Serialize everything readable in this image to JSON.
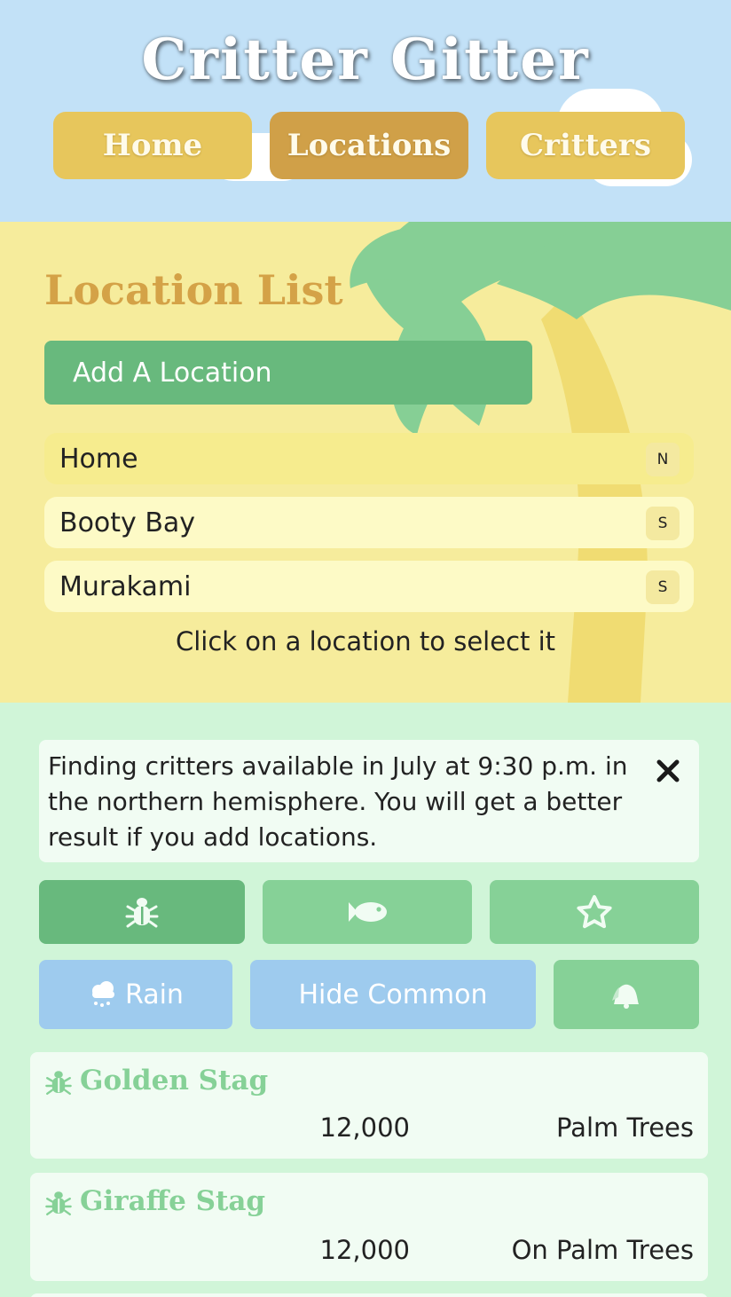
{
  "app": {
    "title": "Critter Gitter"
  },
  "nav": {
    "home": "Home",
    "locations": "Locations",
    "critters": "Critters"
  },
  "location_list": {
    "title": "Location List",
    "add_label": "Add A Location",
    "hint": "Click on a location to select it",
    "items": [
      {
        "name": "Home",
        "hemisphere": "N",
        "selected": true
      },
      {
        "name": "Booty Bay",
        "hemisphere": "S",
        "selected": false
      },
      {
        "name": "Murakami",
        "hemisphere": "S",
        "selected": false
      }
    ]
  },
  "info": {
    "message": "Finding critters available in July at 9:30 p.m. in the northern hemisphere. You will get a better result if you add locations."
  },
  "type_buttons": [
    {
      "icon": "bug-icon",
      "active": true
    },
    {
      "icon": "fish-icon",
      "active": false
    },
    {
      "icon": "star-icon",
      "active": false
    }
  ],
  "filters": {
    "rain": "Rain",
    "hide_common": "Hide Common",
    "bell_icon": "bell-icon"
  },
  "critters": [
    {
      "icon": "bug-icon",
      "name": "Golden Stag",
      "price": "12,000",
      "location": "Palm Trees"
    },
    {
      "icon": "bug-icon",
      "name": "Giraffe Stag",
      "price": "12,000",
      "location": "On Palm Trees"
    }
  ],
  "colors": {
    "sky": "#c2e1f7",
    "sand": "#f6ec9c",
    "grass": "#d0f5d8",
    "nav": "#e7c65c",
    "nav_active": "#d0a048",
    "accent_green": "#68b97d",
    "light_green": "#86d197",
    "blue_button": "#9ecbee",
    "title_gold": "#d4a247"
  }
}
